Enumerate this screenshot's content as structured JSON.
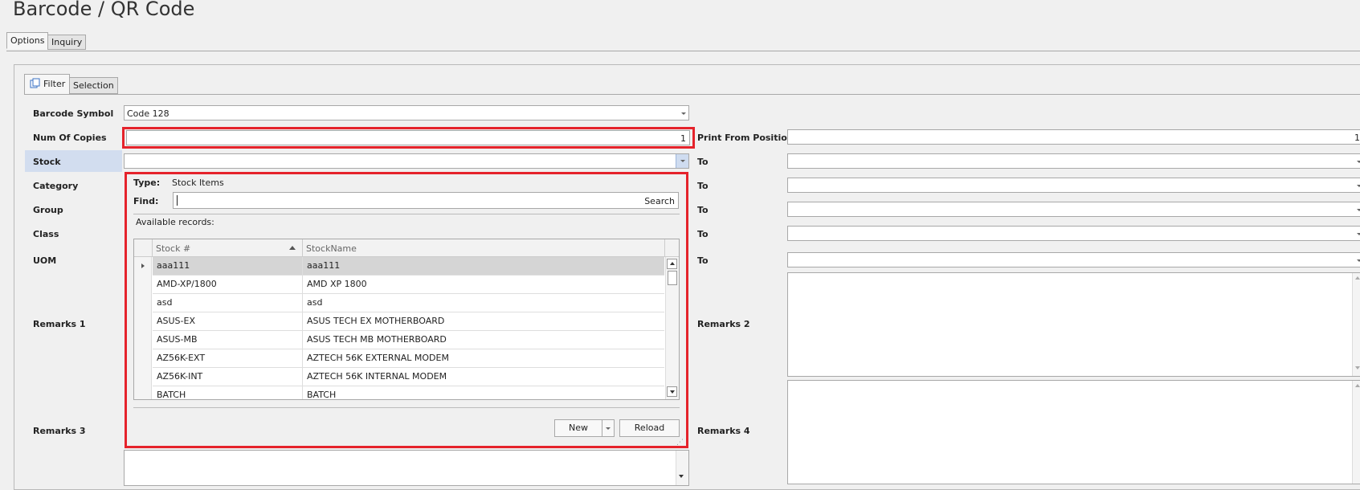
{
  "window": {
    "title": "Barcode / QR Code"
  },
  "outer_tabs": [
    "Options",
    "Inquiry"
  ],
  "inner_tabs": [
    "Filter",
    "Selection"
  ],
  "form": {
    "barcode_symbol_label": "Barcode Symbol",
    "barcode_symbol_value": "Code 128",
    "num_copies_label": "Num Of Copies",
    "num_copies_value": "1",
    "print_from_label": "Print From Position",
    "print_from_value": "1",
    "stock_label": "Stock",
    "category_label": "Category",
    "group_label": "Group",
    "class_label": "Class",
    "uom_label": "UOM",
    "to_label": "To",
    "remarks1_label": "Remarks 1",
    "remarks2_label": "Remarks 2",
    "remarks3_label": "Remarks 3",
    "remarks4_label": "Remarks 4"
  },
  "lookup": {
    "type_label": "Type:",
    "type_value": "Stock Items",
    "find_label": "Find:",
    "find_value": "",
    "search_label": "Search",
    "available_label": "Available records:",
    "columns": [
      "Stock #",
      "StockName"
    ],
    "rows": [
      [
        "aaa111",
        "aaa111"
      ],
      [
        "AMD-XP/1800",
        "AMD XP 1800"
      ],
      [
        "asd",
        "asd"
      ],
      [
        "ASUS-EX",
        "ASUS TECH EX MOTHERBOARD"
      ],
      [
        "ASUS-MB",
        "ASUS TECH MB MOTHERBOARD"
      ],
      [
        "AZ56K-EXT",
        "AZTECH 56K EXTERNAL MODEM"
      ],
      [
        "AZ56K-INT",
        "AZTECH 56K INTERNAL MODEM"
      ],
      [
        "BATCH",
        "BATCH"
      ]
    ],
    "new_label": "New",
    "reload_label": "Reload"
  },
  "colors": {
    "highlight": "#e5232b",
    "selected_row": "#d2ddef"
  }
}
